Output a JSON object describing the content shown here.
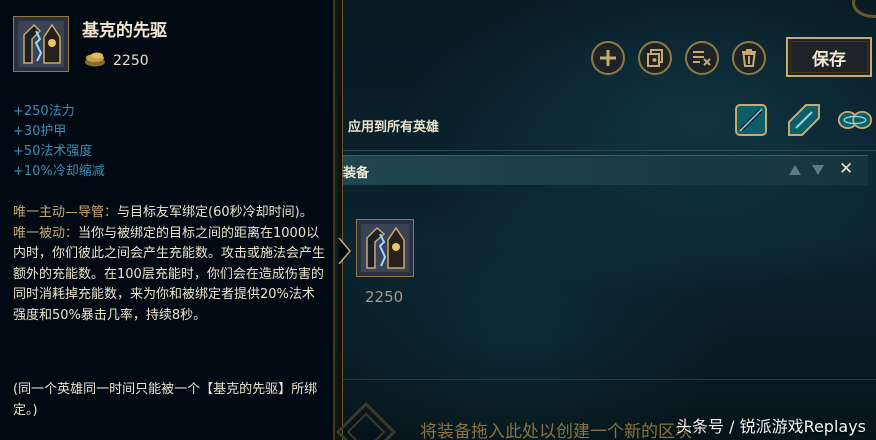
{
  "tooltip": {
    "item_name": "基克的先驱",
    "cost": "2250",
    "stats": [
      "+250法力",
      "+30护甲",
      "+50法术强度",
      "+10%冷却缩减"
    ],
    "active_prefix": "唯一主动—导管：",
    "active_text": "与目标友军绑定(60秒冷却时间)。",
    "passive_prefix": "唯一被动：",
    "passive_text": "当你与被绑定的目标之间的距离在1000以内时，你们彼此之间会产生充能数。攻击或施法会产生额外的充能数。在100层充能时，你们会在造成伤害的同时消耗掉充能数，来为你和被绑定者提供20%法术强度和50%暴击几率，持续8秒。",
    "note": "(同一个英雄同一时间只能被一个【基克的先驱】所绑定。)"
  },
  "toolbar": {
    "icons": [
      "plus-icon",
      "copy-icon",
      "clear-list-icon",
      "trash-icon"
    ],
    "save_label": "保存",
    "apply_label": "应用到所有英雄",
    "map_icons": [
      "summoners-rift-map-icon",
      "howling-abyss-map-icon",
      "twisted-treeline-map-icon"
    ]
  },
  "block": {
    "title": "装备",
    "item_cost": "2250"
  },
  "drop_zone": {
    "text": "将装备拖入此处以创建一个新的区块"
  },
  "watermark": "头条号 / 锐派游戏Replays",
  "colors": {
    "gold": "#c8aa6e",
    "stat_blue": "#3e8db2",
    "panel_bg": "#010a13"
  }
}
